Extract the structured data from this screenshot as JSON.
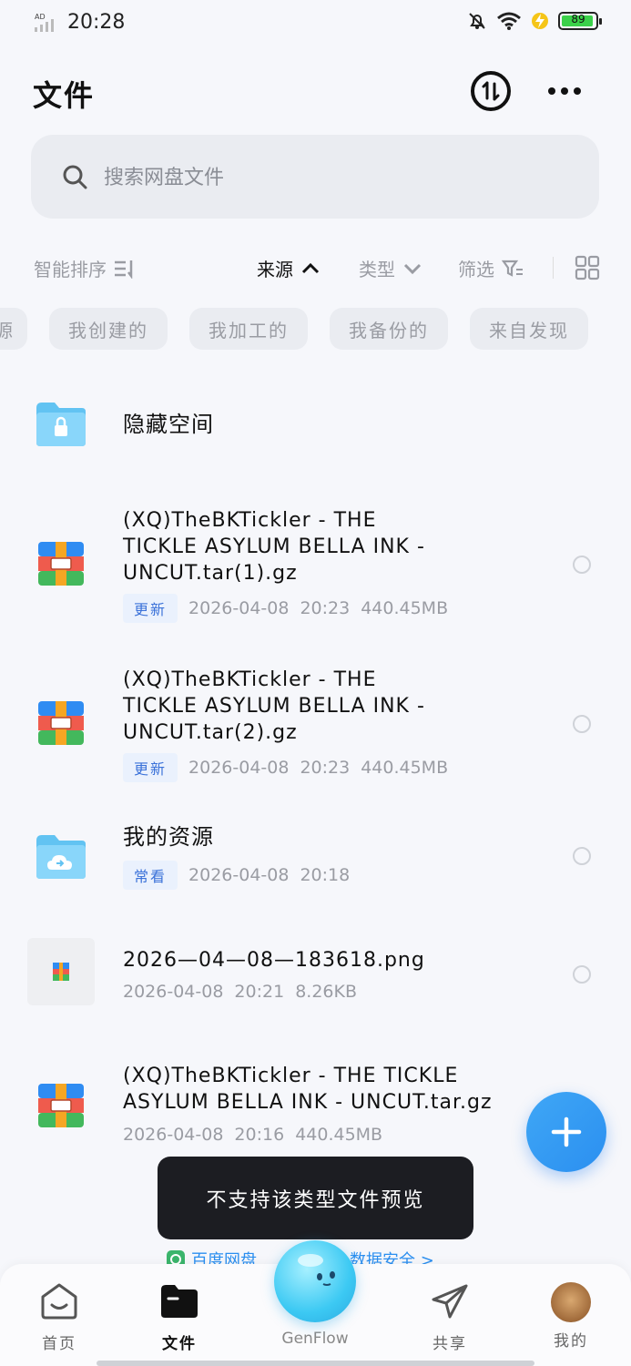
{
  "status": {
    "time": "20:28",
    "battery": "89",
    "network": "AD"
  },
  "header": {
    "title": "文件"
  },
  "search": {
    "placeholder": "搜索网盘文件"
  },
  "sort": {
    "smart": "智能排序",
    "source": "来源",
    "type": "类型",
    "filter": "筛选"
  },
  "chips": [
    "源",
    "我创建的",
    "我加工的",
    "我备份的",
    "来自发现"
  ],
  "files": [
    {
      "name": "隐藏空间",
      "tag": "",
      "date": "",
      "time": "",
      "size": "",
      "icon": "lock-folder-icon"
    },
    {
      "name_lines": [
        "(XQ)TheBKTickler - THE",
        "TICKLE ASYLUM BELLA INK -",
        "UNCUT.tar(1).gz"
      ],
      "tag": "更新",
      "date": "2026-04-08",
      "time": "20:23",
      "size": "440.45MB",
      "icon": "archive-icon"
    },
    {
      "name_lines": [
        "(XQ)TheBKTickler - THE",
        "TICKLE ASYLUM BELLA INK -",
        "UNCUT.tar(2).gz"
      ],
      "tag": "更新",
      "date": "2026-04-08",
      "time": "20:23",
      "size": "440.45MB",
      "icon": "archive-icon"
    },
    {
      "name": "我的资源",
      "tag": "常看",
      "date": "2026-04-08",
      "time": "20:18",
      "size": "",
      "icon": "cloud-folder-icon"
    },
    {
      "name": "2026—04—08—183618.png",
      "tag": "",
      "date": "2026-04-08",
      "time": "20:21",
      "size": "8.26KB",
      "icon": "image-thumbnail"
    },
    {
      "name_lines": [
        "(XQ)TheBKTickler - THE TICKLE",
        "ASYLUM BELLA INK - UNCUT.tar.gz"
      ],
      "tag": "",
      "date": "2026-04-08",
      "time": "20:16",
      "size": "440.45MB",
      "icon": "archive-icon"
    }
  ],
  "toast": "不支持该类型文件预览",
  "banner": {
    "left": "百度网盘",
    "right": "数据安全 >"
  },
  "nav": [
    {
      "label": "首页"
    },
    {
      "label": "文件"
    },
    {
      "label": "GenFlow"
    },
    {
      "label": "共享"
    },
    {
      "label": "我的"
    }
  ],
  "colors": {
    "accent": "#2b8ff0",
    "tag_bg": "#eaf1fd",
    "toast_bg": "#1c1d22"
  }
}
